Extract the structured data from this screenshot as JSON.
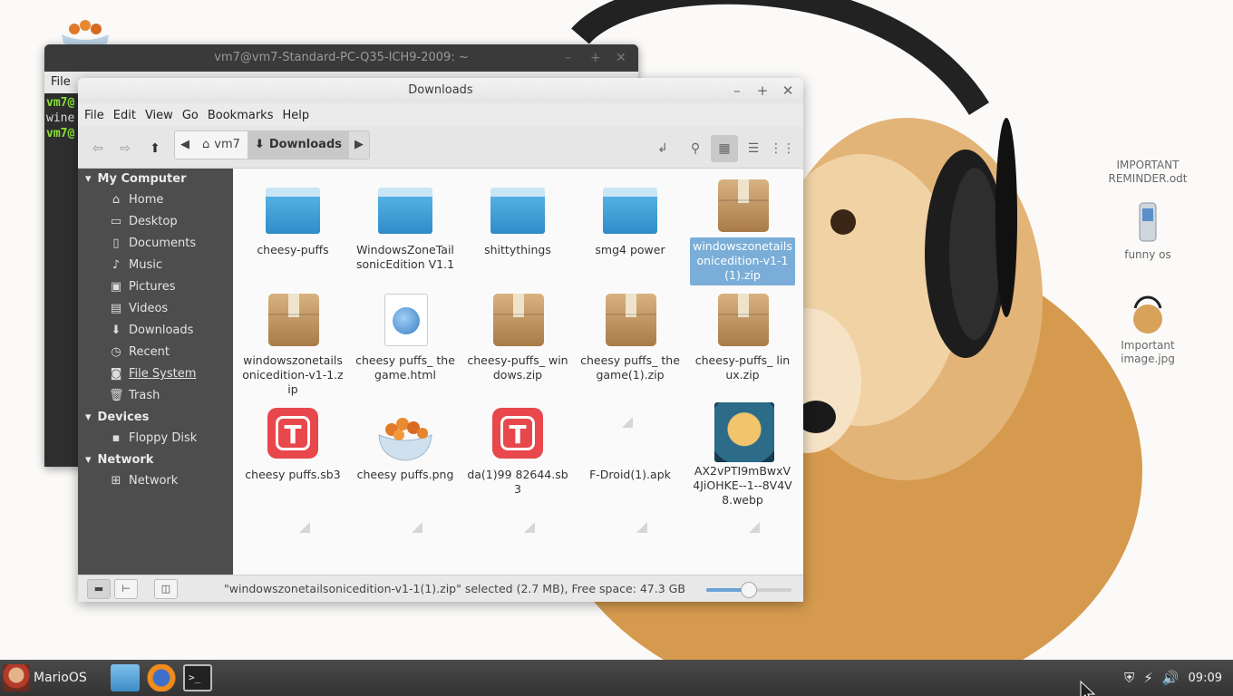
{
  "desktop": {
    "icons": [
      {
        "label": "IMPORTANT REMINDER.odt",
        "icon": "document-icon"
      },
      {
        "label": "funny os",
        "icon": "phone-icon"
      },
      {
        "label": "Important image.jpg",
        "icon": "image-icon"
      }
    ]
  },
  "terminal": {
    "title": "vm7@vm7-Standard-PC-Q35-ICH9-2009: ~",
    "menu": "File",
    "lines": [
      "vm7@",
      "wine",
      "vm7@"
    ]
  },
  "filemanager": {
    "title": "Downloads",
    "menu": [
      "File",
      "Edit",
      "View",
      "Go",
      "Bookmarks",
      "Help"
    ],
    "path": {
      "home": "vm7",
      "current": "Downloads"
    },
    "sidebar": {
      "sections": [
        {
          "title": "My Computer",
          "items": [
            {
              "label": "Home",
              "icon": "home-icon"
            },
            {
              "label": "Desktop",
              "icon": "desktop-icon"
            },
            {
              "label": "Documents",
              "icon": "documents-icon"
            },
            {
              "label": "Music",
              "icon": "music-icon"
            },
            {
              "label": "Pictures",
              "icon": "pictures-icon"
            },
            {
              "label": "Videos",
              "icon": "videos-icon"
            },
            {
              "label": "Downloads",
              "icon": "downloads-icon"
            },
            {
              "label": "Recent",
              "icon": "recent-icon"
            },
            {
              "label": "File System",
              "icon": "filesystem-icon"
            },
            {
              "label": "Trash",
              "icon": "trash-icon"
            }
          ]
        },
        {
          "title": "Devices",
          "items": [
            {
              "label": "Floppy Disk",
              "icon": "floppy-icon"
            }
          ]
        },
        {
          "title": "Network",
          "items": [
            {
              "label": "Network",
              "icon": "network-icon"
            }
          ]
        }
      ]
    },
    "files": [
      {
        "name": "cheesy-puffs",
        "type": "folder"
      },
      {
        "name": "WindowsZoneTailsonicEdition V1.1",
        "type": "folder"
      },
      {
        "name": "shittythings",
        "type": "folder"
      },
      {
        "name": "smg4 power",
        "type": "folder"
      },
      {
        "name": "windowszonetailsonicedition-v1-1(1).zip",
        "type": "archive",
        "selected": true
      },
      {
        "name": "windowszonetailsonicedition-v1-1.zip",
        "type": "archive"
      },
      {
        "name": "cheesy puffs_ the game.html",
        "type": "html"
      },
      {
        "name": "cheesy-puffs_ windows.zip",
        "type": "archive"
      },
      {
        "name": "cheesy puffs_ the game(1).zip",
        "type": "archive"
      },
      {
        "name": "cheesy-puffs_ linux.zip",
        "type": "archive"
      },
      {
        "name": "cheesy puffs.sb3",
        "type": "sb3"
      },
      {
        "name": "cheesy puffs.png",
        "type": "png"
      },
      {
        "name": "da(1)99 82644.sb3",
        "type": "sb3"
      },
      {
        "name": "F-Droid(1).apk",
        "type": "broken"
      },
      {
        "name": "AX2vPTI9mBwxV4JiOHKE--1--8V4V8.webp",
        "type": "webp"
      }
    ],
    "status": "\"windowszonetailsonicedition-v1-1(1).zip\" selected (2.7 MB), Free space: 47.3 GB",
    "zoom_fraction": 0.5
  },
  "taskbar": {
    "menu_label": "MarioOS",
    "clock": "09:09"
  }
}
